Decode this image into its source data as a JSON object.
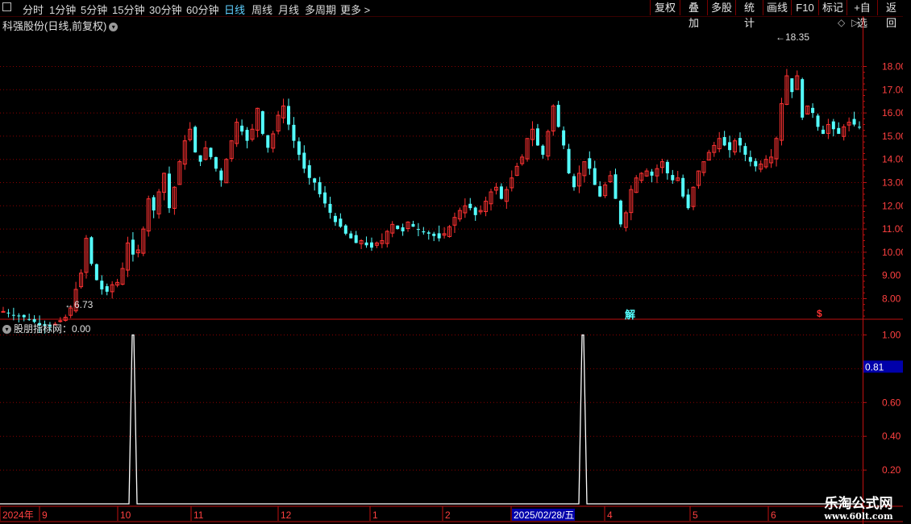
{
  "toolbar": {
    "periods": [
      "分时",
      "1分钟",
      "5分钟",
      "15分钟",
      "30分钟",
      "60分钟",
      "日线",
      "周线",
      "月线",
      "多周期",
      "更多 >"
    ],
    "active_period": "日线",
    "buttons": [
      "复权",
      "叠加",
      "多股",
      "统计",
      "画线",
      "F10",
      "标记",
      "+自选",
      "返回"
    ]
  },
  "main": {
    "title": "科强股份(日线,前复权)",
    "max_label": "18.35",
    "min_label": "6.73",
    "marker_jie": "解",
    "marker_s": "$"
  },
  "sub": {
    "title": "股朋指标网：0.00",
    "cursor_value": "0.81"
  },
  "xaxis": {
    "year": "2024年",
    "months": [
      "9",
      "10",
      "11",
      "12",
      "1",
      "2",
      "2025/02/28/五",
      "4",
      "5",
      "6"
    ]
  },
  "watermark": {
    "line1": "乐淘公式网",
    "line2": "www.60lt.com"
  },
  "colors": {
    "up": "#ff3232",
    "down": "#54ffff",
    "grid": "#8b0000",
    "axis": "#c01010",
    "cursor": "#0000aa",
    "ma": "#ffffff"
  },
  "chart_data": [
    {
      "type": "candlestick",
      "title": "科强股份(日线,前复权)",
      "yticks": [
        8.0,
        9.0,
        10.0,
        11.0,
        12.0,
        13.0,
        14.0,
        15.0,
        16.0,
        17.0,
        18.0
      ],
      "ylim": [
        7.0,
        18.6
      ],
      "max": 18.35,
      "min": 6.73,
      "close_path": [
        7.45,
        7.4,
        7.3,
        7.25,
        7.2,
        7.1,
        7.0,
        6.95,
        6.9,
        6.85,
        6.9,
        7.05,
        7.2,
        7.6,
        8.4,
        9.1,
        10.6,
        9.5,
        8.8,
        8.4,
        8.3,
        8.6,
        8.7,
        9.3,
        10.4,
        9.9,
        10.1,
        11.0,
        12.3,
        11.8,
        12.6,
        13.4,
        11.9,
        12.8,
        13.9,
        14.8,
        15.3,
        14.3,
        13.9,
        14.5,
        14.1,
        13.6,
        13.1,
        14.0,
        14.8,
        15.6,
        15.2,
        14.8,
        15.3,
        16.2,
        15.1,
        14.5,
        15.1,
        15.9,
        16.3,
        15.5,
        14.8,
        14.2,
        13.6,
        13.2,
        13.0,
        12.5,
        12.1,
        11.7,
        11.3,
        11.1,
        10.8,
        10.6,
        10.4,
        10.5,
        10.3,
        10.2,
        10.4,
        10.5,
        10.9,
        11.2,
        11.0,
        10.9,
        11.3,
        11.1,
        11.0,
        10.9,
        10.8,
        10.7,
        10.6,
        10.8,
        11.1,
        11.5,
        11.8,
        12.0,
        11.9,
        11.6,
        11.8,
        12.2,
        12.6,
        12.8,
        12.3,
        12.7,
        13.2,
        13.7,
        14.1,
        14.9,
        15.3,
        14.6,
        14.2,
        15.2,
        16.3,
        15.4,
        14.6,
        13.4,
        12.8,
        13.4,
        13.9,
        13.6,
        12.9,
        12.4,
        12.9,
        13.3,
        12.3,
        11.2,
        11.7,
        12.7,
        13.2,
        13.4,
        13.5,
        13.3,
        13.6,
        13.9,
        13.4,
        13.1,
        13.2,
        12.4,
        11.9,
        12.8,
        13.5,
        13.9,
        14.3,
        14.6,
        14.9,
        14.6,
        14.4,
        14.8,
        14.6,
        14.2,
        13.9,
        13.7,
        13.8,
        14.0,
        14.1,
        14.9,
        16.4,
        17.6,
        16.9,
        17.6,
        15.8,
        16.3,
        16.0,
        15.4,
        15.1,
        15.5,
        15.3,
        15.1,
        15.4,
        15.6,
        15.5,
        15.4
      ],
      "xlabels": [
        "2024年",
        "9",
        "10",
        "11",
        "12",
        "1",
        "2",
        "2025/02/28/五",
        "4",
        "5",
        "6"
      ]
    },
    {
      "type": "line",
      "title": "股朋指标网",
      "value": 0.0,
      "yticks": [
        0.2,
        0.4,
        0.6,
        0.8,
        1.0
      ],
      "ylim": [
        0,
        1.05
      ],
      "spikes": [
        {
          "month": "10",
          "value": 1.0
        },
        {
          "month": "2025/02/28/五",
          "value": 1.0
        }
      ]
    }
  ]
}
